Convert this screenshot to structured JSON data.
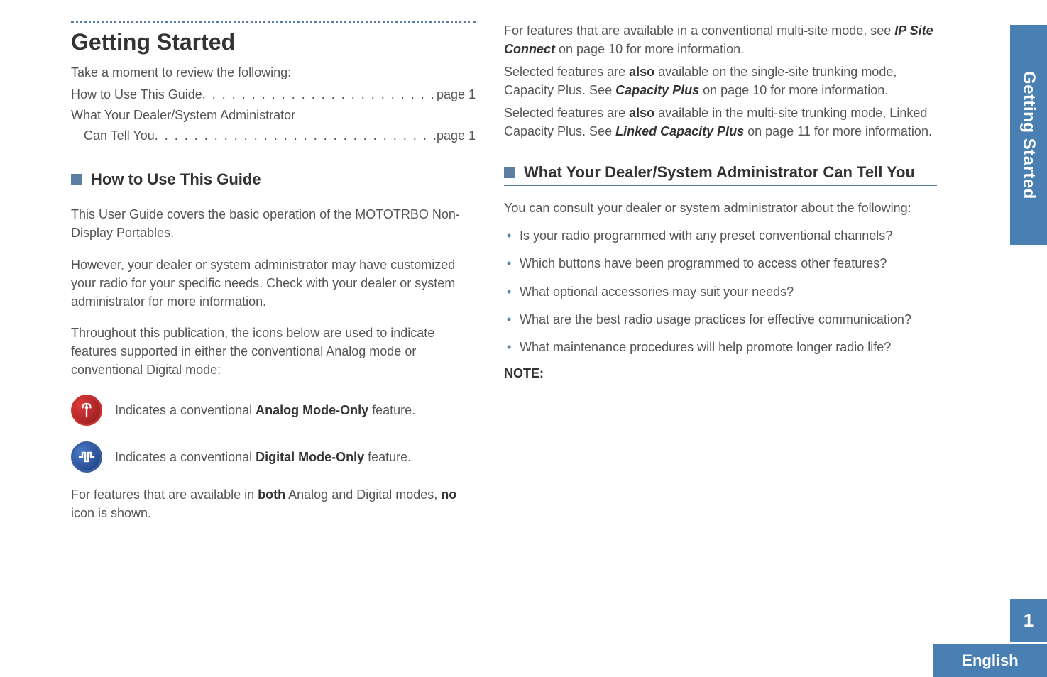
{
  "chapter": {
    "title": "Getting Started",
    "intro": "Take a moment to review the following:"
  },
  "toc": {
    "line1_label": "How to Use This Guide",
    "line1_page": "page 1",
    "line2_label": "What Your Dealer/System Administrator",
    "line2b_label": "Can Tell You",
    "line2_page": "page 1"
  },
  "section1": {
    "heading": "How to Use This Guide",
    "p1": "This User Guide covers the basic operation of the MOTOTRBO Non-Display Portables.",
    "p2": "However, your dealer or system administrator may have customized your radio for your specific needs. Check with your dealer or system administrator for more information.",
    "p3": "Throughout this publication, the icons below are used to indicate features supported in either the conventional Analog mode or conventional Digital mode:",
    "analog_desc_pre": "Indicates a conventional ",
    "analog_desc_bold": "Analog Mode-Only",
    "analog_desc_post": " feature.",
    "digital_desc_pre": "Indicates a conventional ",
    "digital_desc_bold": "Digital Mode-Only",
    "digital_desc_post": " feature.",
    "p4_pre": "For features that are available in ",
    "p4_bold1": "both",
    "p4_mid": " Analog and Digital modes, ",
    "p4_bold2": "no",
    "p4_post": " icon is shown."
  },
  "right": {
    "p1_pre": "For features that are available in a conventional multi-site mode, see ",
    "p1_link": "IP Site Connect",
    "p1_post": " on page 10 for more information.",
    "p2_pre": "Selected features are ",
    "p2_bold": "also",
    "p2_mid": " available on the single-site trunking mode, Capacity Plus. See ",
    "p2_link": "Capacity Plus",
    "p2_post": " on page 10 for more information.",
    "p3_pre": "Selected features are ",
    "p3_bold": "also",
    "p3_mid": " available in the multi-site trunking mode, Linked Capacity Plus. See ",
    "p3_link": "Linked Capacity Plus",
    "p3_post": " on page 11 for more information."
  },
  "section2": {
    "heading": "What Your Dealer/System Administrator Can Tell You",
    "intro": "You can consult your dealer or system administrator about the following:",
    "bullets": [
      "Is your radio programmed with any preset conventional channels?",
      "Which buttons have been programmed to access other features?",
      "What optional accessories may suit your needs?",
      "What are the best radio usage practices for effective communication?",
      "What maintenance procedures will help promote longer radio life?"
    ],
    "note": "NOTE:"
  },
  "sidebar": {
    "tab_label": "Getting Started",
    "page_number": "1",
    "language": "English"
  }
}
